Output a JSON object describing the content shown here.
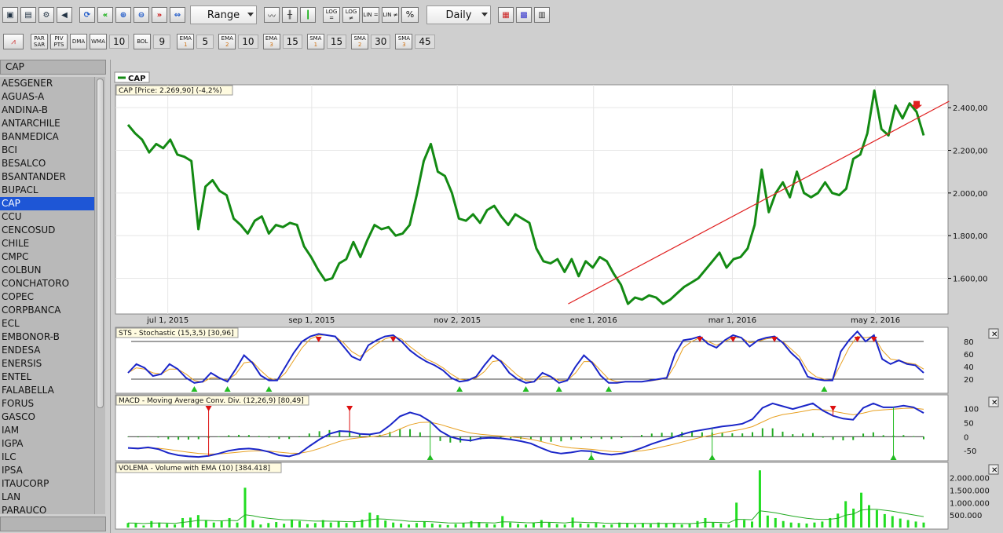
{
  "toolbar": {
    "range_label": "Range",
    "period_label": "Daily",
    "log_labels": [
      "LOG =",
      "LOG ≠",
      "LIN =",
      "LIN ≠"
    ],
    "percent_label": "%"
  },
  "indicator_bar": {
    "items": [
      {
        "name": "parsar",
        "label": "PAR SAR"
      },
      {
        "name": "pivpts",
        "label": "PIV PTS"
      },
      {
        "name": "dma",
        "label": "DMA"
      },
      {
        "name": "wma",
        "label": "WMA",
        "value": "10"
      },
      {
        "name": "bol",
        "label": "BOL",
        "value": "9"
      },
      {
        "name": "ema1",
        "label": "EMA",
        "sub": "1",
        "value": "5"
      },
      {
        "name": "ema2",
        "label": "EMA",
        "sub": "2",
        "value": "10"
      },
      {
        "name": "ema3",
        "label": "EMA",
        "sub": "3",
        "value": "15"
      },
      {
        "name": "sma1",
        "label": "SMA",
        "sub": "1",
        "value": "15"
      },
      {
        "name": "sma2",
        "label": "SMA",
        "sub": "2",
        "value": "30"
      },
      {
        "name": "sma3",
        "label": "SMA",
        "sub": "3",
        "value": "45"
      }
    ]
  },
  "sidebar": {
    "title": "CAP",
    "selected": "CAP",
    "tickers": [
      "AESGENER",
      "AGUAS-A",
      "ANDINA-B",
      "ANTARCHILE",
      "BANMEDICA",
      "BCI",
      "BESALCO",
      "BSANTANDER",
      "BUPACL",
      "CAP",
      "CCU",
      "CENCOSUD",
      "CHILE",
      "CMPC",
      "COLBUN",
      "CONCHATORO",
      "COPEC",
      "CORPBANCA",
      "ECL",
      "EMBONOR-B",
      "ENDESA",
      "ENERSIS",
      "ENTEL",
      "FALABELLA",
      "FORUS",
      "GASCO",
      "IAM",
      "IGPA",
      "ILC",
      "IPSA",
      "ITAUCORP",
      "LAN",
      "PARAUCO"
    ]
  },
  "colors": {
    "price": "#138a13",
    "trend": "#e02020",
    "stoch_k": "#1a25c8",
    "stoch_d": "#e8a020",
    "volume": "#22dd22",
    "buy_marker": "#22bb22",
    "sell_marker": "#dd1111",
    "selected": "#1e56d6"
  },
  "chart": {
    "legend": "CAP",
    "price_title": "CAP [Price: 2.269,90] (-4,2%)",
    "price_ticks": [
      "2.400,00",
      "2.200,00",
      "2.000,00",
      "1.800,00",
      "1.600,00"
    ],
    "date_ticks": [
      "jul 1, 2015",
      "sep 1, 2015",
      "nov 2, 2015",
      "ene 1, 2016",
      "mar 1, 2016",
      "may 2, 2016"
    ],
    "stoch_title": "STS - Stochastic (15,3,5) [30,96]",
    "stoch_ticks": [
      "80",
      "60",
      "40",
      "20"
    ],
    "macd_title": "MACD - Moving Average Conv. Div. (12,26,9) [80,49]",
    "macd_ticks": [
      "100",
      "50",
      "0",
      "-50"
    ],
    "vol_title": "VOLEMA - Volume with EMA (10) [384.418]",
    "vol_ticks": [
      "2.000.000",
      "1.500.000",
      "1.000.000",
      "500.000"
    ]
  },
  "chart_data": {
    "type": "line",
    "price_series": [
      2320,
      2280,
      2250,
      2190,
      2230,
      2210,
      2250,
      2180,
      2170,
      2150,
      1830,
      2030,
      2060,
      2010,
      1990,
      1880,
      1850,
      1810,
      1870,
      1890,
      1810,
      1850,
      1840,
      1860,
      1850,
      1750,
      1700,
      1640,
      1590,
      1600,
      1670,
      1690,
      1770,
      1700,
      1780,
      1850,
      1830,
      1840,
      1800,
      1810,
      1850,
      1990,
      2150,
      2230,
      2100,
      2080,
      2000,
      1880,
      1870,
      1900,
      1860,
      1920,
      1940,
      1890,
      1850,
      1900,
      1880,
      1860,
      1740,
      1680,
      1670,
      1690,
      1630,
      1690,
      1610,
      1680,
      1650,
      1700,
      1680,
      1620,
      1570,
      1480,
      1510,
      1500,
      1520,
      1510,
      1480,
      1500,
      1530,
      1560,
      1580,
      1600,
      1640,
      1680,
      1720,
      1650,
      1690,
      1700,
      1740,
      1850,
      2110,
      1910,
      2000,
      2050,
      1980,
      2100,
      2000,
      1980,
      2000,
      2050,
      2000,
      1990,
      2020,
      2160,
      2180,
      2280,
      2480,
      2300,
      2270,
      2410,
      2350,
      2420,
      2380,
      2270
    ],
    "trend_line": {
      "from": [
        2015.97,
        1480
      ],
      "to": [
        2016.42,
        2430
      ]
    },
    "stoch_k": [
      30,
      44,
      38,
      25,
      28,
      44,
      36,
      22,
      14,
      16,
      30,
      22,
      16,
      36,
      58,
      46,
      26,
      18,
      18,
      40,
      62,
      80,
      88,
      92,
      90,
      88,
      72,
      56,
      50,
      74,
      82,
      88,
      90,
      80,
      66,
      56,
      48,
      42,
      34,
      22,
      16,
      18,
      24,
      42,
      58,
      48,
      30,
      20,
      14,
      16,
      30,
      24,
      14,
      18,
      40,
      58,
      46,
      26,
      14,
      14,
      16,
      16,
      16,
      18,
      20,
      22,
      60,
      82,
      84,
      88,
      76,
      70,
      82,
      90,
      86,
      72,
      82,
      86,
      88,
      78,
      62,
      50,
      24,
      20,
      18,
      18,
      64,
      82,
      96,
      80,
      90,
      52,
      44,
      50,
      44,
      42,
      30
    ],
    "stoch_d": [
      30,
      38,
      36,
      30,
      28,
      36,
      36,
      28,
      18,
      15,
      22,
      22,
      18,
      28,
      46,
      48,
      34,
      22,
      18,
      30,
      50,
      70,
      84,
      90,
      90,
      88,
      78,
      64,
      56,
      66,
      76,
      84,
      88,
      84,
      72,
      62,
      52,
      46,
      38,
      28,
      20,
      18,
      22,
      32,
      48,
      50,
      38,
      26,
      18,
      16,
      24,
      24,
      18,
      18,
      30,
      48,
      48,
      34,
      20,
      16,
      16,
      16,
      16,
      17,
      19,
      21,
      42,
      70,
      80,
      86,
      80,
      74,
      80,
      86,
      86,
      78,
      80,
      84,
      86,
      80,
      68,
      56,
      34,
      24,
      20,
      18,
      44,
      70,
      88,
      86,
      88,
      66,
      52,
      50,
      46,
      44,
      36
    ],
    "macd": [
      -40,
      -42,
      -38,
      -44,
      -58,
      -66,
      -70,
      -72,
      -68,
      -60,
      -50,
      -44,
      -42,
      -46,
      -54,
      -66,
      -70,
      -60,
      -34,
      -10,
      10,
      20,
      18,
      10,
      8,
      14,
      40,
      72,
      86,
      76,
      54,
      20,
      0,
      -10,
      -14,
      -6,
      -4,
      -6,
      -10,
      -16,
      -24,
      -40,
      -54,
      -60,
      -56,
      -50,
      -52,
      -60,
      -64,
      -60,
      -52,
      -40,
      -26,
      -14,
      -4,
      8,
      18,
      24,
      30,
      36,
      40,
      46,
      62,
      102,
      118,
      108,
      98,
      108,
      118,
      92,
      74,
      64,
      60,
      102,
      118,
      104,
      104,
      110,
      104,
      84
    ],
    "volume_bars": [
      180000,
      160000,
      80000,
      260000,
      200000,
      150000,
      120000,
      380000,
      400000,
      500000,
      300000,
      200000,
      250000,
      380000,
      200000,
      1600000,
      300000,
      120000,
      180000,
      220000,
      150000,
      320000,
      260000,
      140000,
      180000,
      300000,
      200000,
      240000,
      180000,
      220000,
      320000,
      600000,
      500000,
      280000,
      200000,
      160000,
      120000,
      180000,
      240000,
      160000,
      120000,
      100000,
      140000,
      180000,
      260000,
      220000,
      160000,
      120000,
      460000,
      200000,
      140000,
      120000,
      180000,
      300000,
      200000,
      140000,
      120000,
      400000,
      160000,
      140000,
      180000,
      100000,
      120000,
      200000,
      160000,
      120000,
      180000,
      140000,
      200000,
      160000,
      180000,
      120000,
      140000,
      260000,
      380000,
      200000,
      160000,
      120000,
      1000000,
      300000,
      240000,
      2300000,
      480000,
      380000,
      260000,
      200000,
      180000,
      160000,
      200000,
      240000,
      380000,
      560000,
      1060000,
      760000,
      1400000,
      900000,
      700000,
      540000,
      460000,
      360000,
      300000,
      240000,
      200000
    ],
    "xlabel": "",
    "ylabel": ""
  }
}
